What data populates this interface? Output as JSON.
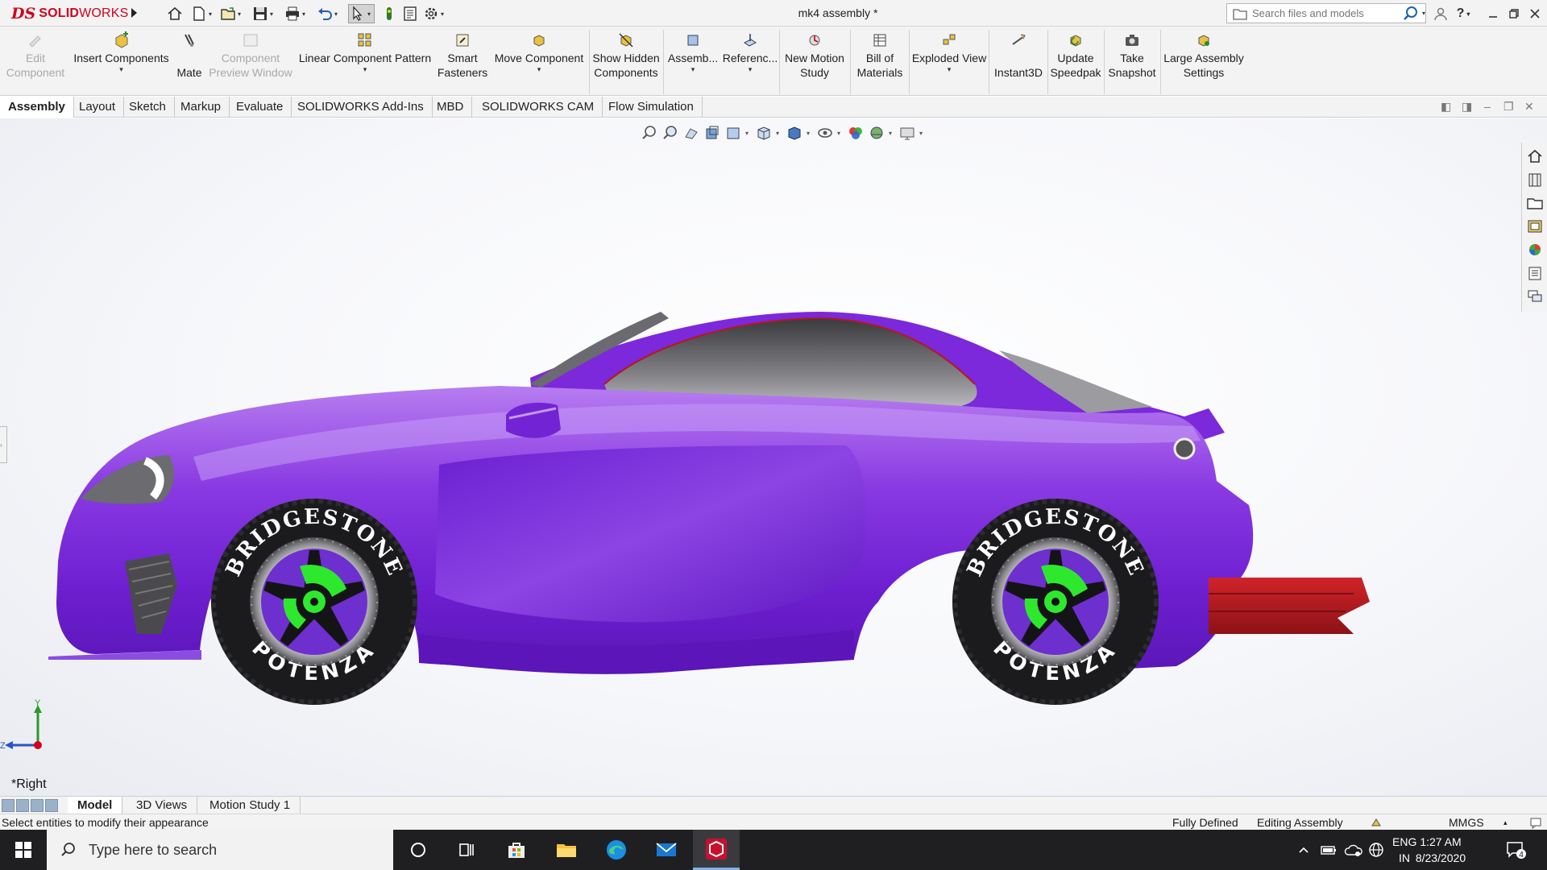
{
  "app": {
    "logo_prefix": "DS",
    "logo_name": "SOLID",
    "logo_name_suffix": "WORKS",
    "doc_title": "mk4 assembly *",
    "search_placeholder": "Search files and models"
  },
  "command_manager": {
    "edit_component": [
      "Edit",
      "Component"
    ],
    "insert_components": "Insert Components",
    "mate": "Mate",
    "component_preview": [
      "Component",
      "Preview Window"
    ],
    "linear_pattern": "Linear Component Pattern",
    "smart_fasteners": [
      "Smart",
      "Fasteners"
    ],
    "move_component": "Move Component",
    "show_hidden": [
      "Show Hidden",
      "Components"
    ],
    "assembly_features": "Assemb...",
    "reference_geometry": "Referenc...",
    "new_motion_study": [
      "New Motion",
      "Study"
    ],
    "bill_of_materials": [
      "Bill of",
      "Materials"
    ],
    "exploded_view": "Exploded View",
    "instant3d": "Instant3D",
    "update_speedpak": [
      "Update",
      "Speedpak"
    ],
    "take_snapshot": [
      "Take",
      "Snapshot"
    ],
    "large_assembly": [
      "Large Assembly",
      "Settings"
    ]
  },
  "tabs": [
    "Assembly",
    "Layout",
    "Sketch",
    "Markup",
    "Evaluate",
    "SOLIDWORKS Add-Ins",
    "MBD",
    "SOLIDWORKS CAM",
    "Flow Simulation"
  ],
  "viewport": {
    "tire_brand": "BRIDGESTONE",
    "tire_model": "POTENZA",
    "view_name": "*Right",
    "triad_y": "Y",
    "triad_z": "Z"
  },
  "bottom_tabs": [
    "Model",
    "3D Views",
    "Motion Study 1"
  ],
  "status": {
    "message": "Select entities to modify their appearance",
    "definition": "Fully Defined",
    "mode": "Editing Assembly",
    "units": "MMGS",
    "units_caret": "▴"
  },
  "taskbar": {
    "search_text": "Type here to search",
    "lang_top": "ENG",
    "lang_bottom": "IN",
    "time": "1:27 AM",
    "date": "8/23/2020",
    "notification_count": "4"
  },
  "colors": {
    "brand_red": "#d0021b",
    "car_body": "#7a22d9",
    "brake_caliper": "#2ee82e",
    "diffuser": "#b3161b"
  },
  "icons": [
    "home-icon",
    "new-doc-icon",
    "open-icon",
    "save-icon",
    "print-icon",
    "undo-icon",
    "select-icon",
    "rebuild-icon",
    "file-props-icon",
    "options-icon",
    "search-icon",
    "user-icon",
    "help-icon",
    "minimize-icon",
    "restore-icon",
    "close-icon"
  ]
}
